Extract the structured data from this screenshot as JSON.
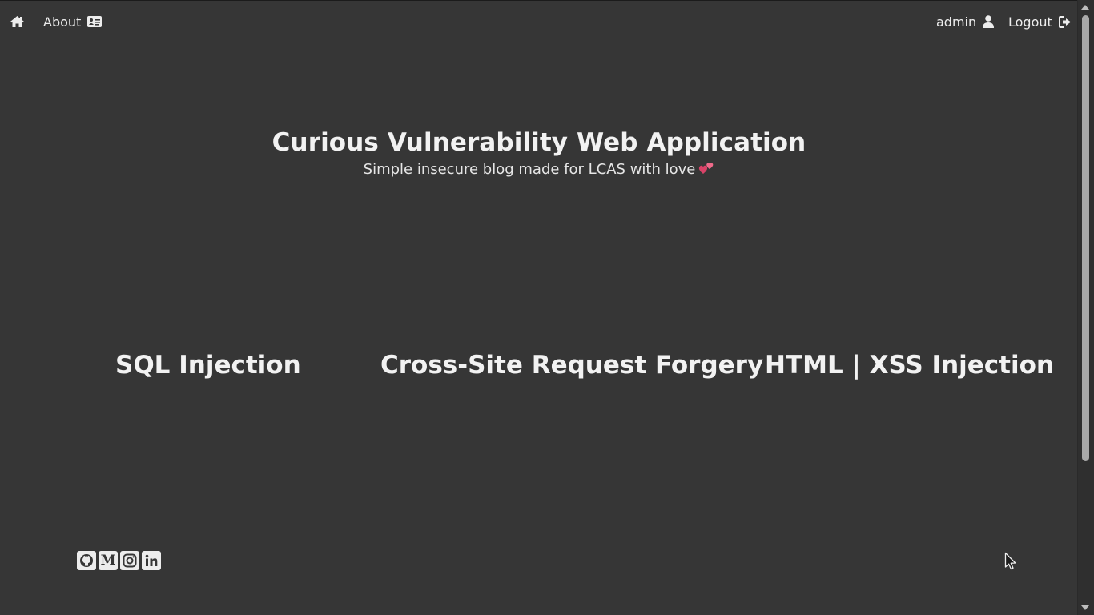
{
  "nav": {
    "home_icon": "home-icon",
    "about_label": "About",
    "about_icon": "id-card-icon",
    "user_label": "admin",
    "user_icon": "user-icon",
    "logout_label": "Logout",
    "logout_icon": "sign-out-icon"
  },
  "hero": {
    "title": "Curious Vulnerability Web Application",
    "subtitle": "Simple insecure blog made for LCAS with love",
    "heart_icon": "two-hearts-icon"
  },
  "categories": [
    {
      "label": "SQL Injection"
    },
    {
      "label": "Cross-Site Request Forgery"
    },
    {
      "label": "HTML | XSS Injection"
    }
  ],
  "socials": [
    {
      "icon": "github-icon"
    },
    {
      "icon": "medium-icon",
      "glyph": "M"
    },
    {
      "icon": "instagram-icon"
    },
    {
      "icon": "linkedin-icon"
    }
  ],
  "colors": {
    "background": "#363636",
    "text": "#ededed",
    "heart": "#e84a6f"
  }
}
